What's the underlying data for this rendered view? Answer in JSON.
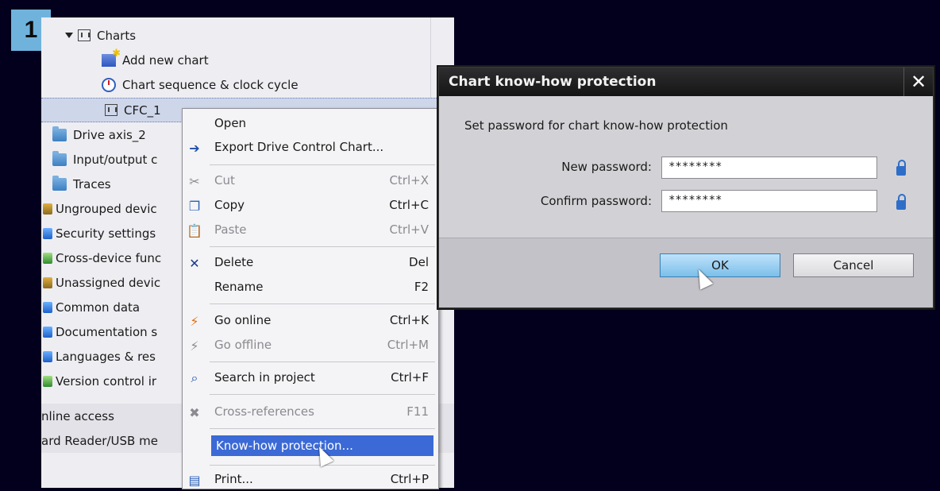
{
  "step": "1",
  "tree": {
    "rows": [
      {
        "label": "Charts"
      },
      {
        "label": "Add new chart"
      },
      {
        "label": "Chart sequence & clock cycle"
      },
      {
        "label": "CFC_1"
      },
      {
        "label": "Drive axis_2"
      },
      {
        "label": "Input/output c"
      },
      {
        "label": "Traces"
      },
      {
        "label": "Ungrouped devic"
      },
      {
        "label": "Security settings"
      },
      {
        "label": "Cross-device func"
      },
      {
        "label": "Unassigned devic"
      },
      {
        "label": "Common data"
      },
      {
        "label": "Documentation s"
      },
      {
        "label": "Languages & res"
      },
      {
        "label": "Version control ir"
      },
      {
        "label": "nline access"
      },
      {
        "label": "ard Reader/USB me"
      }
    ]
  },
  "menu": {
    "items": [
      {
        "label": "Open",
        "shortcut": ""
      },
      {
        "label": "Export Drive Control Chart...",
        "shortcut": ""
      },
      {
        "label": "Cut",
        "shortcut": "Ctrl+X"
      },
      {
        "label": "Copy",
        "shortcut": "Ctrl+C"
      },
      {
        "label": "Paste",
        "shortcut": "Ctrl+V"
      },
      {
        "label": "Delete",
        "shortcut": "Del"
      },
      {
        "label": "Rename",
        "shortcut": "F2"
      },
      {
        "label": "Go online",
        "shortcut": "Ctrl+K"
      },
      {
        "label": "Go offline",
        "shortcut": "Ctrl+M"
      },
      {
        "label": "Search in project",
        "shortcut": "Ctrl+F"
      },
      {
        "label": "Cross-references",
        "shortcut": "F11"
      },
      {
        "label": "Know-how protection...",
        "shortcut": ""
      },
      {
        "label": "Print...",
        "shortcut": "Ctrl+P"
      }
    ]
  },
  "dialog": {
    "title": "Chart know-how protection",
    "close_label": "✕",
    "description": "Set password for chart know-how protection",
    "new_password_label": "New password:",
    "new_password_value": "********",
    "confirm_password_label": "Confirm password:",
    "confirm_password_value": "********",
    "ok_label": "OK",
    "cancel_label": "Cancel"
  }
}
